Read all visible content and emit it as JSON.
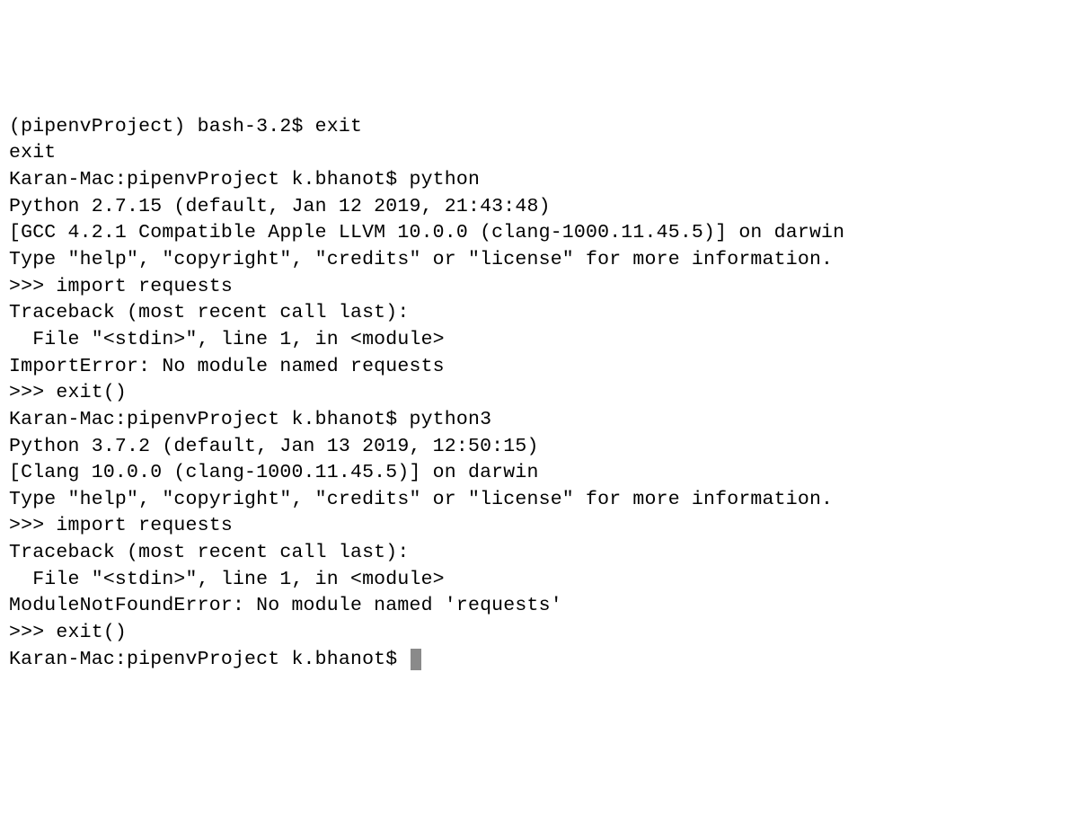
{
  "lines": [
    "(pipenvProject) bash-3.2$ exit",
    "exit",
    "Karan-Mac:pipenvProject k.bhanot$ python",
    "Python 2.7.15 (default, Jan 12 2019, 21:43:48) ",
    "[GCC 4.2.1 Compatible Apple LLVM 10.0.0 (clang-1000.11.45.5)] on darwin",
    "Type \"help\", \"copyright\", \"credits\" or \"license\" for more information.",
    ">>> import requests",
    "Traceback (most recent call last):",
    "  File \"<stdin>\", line 1, in <module>",
    "ImportError: No module named requests",
    ">>> exit()",
    "Karan-Mac:pipenvProject k.bhanot$ python3",
    "Python 3.7.2 (default, Jan 13 2019, 12:50:15) ",
    "[Clang 10.0.0 (clang-1000.11.45.5)] on darwin",
    "Type \"help\", \"copyright\", \"credits\" or \"license\" for more information.",
    ">>> import requests",
    "Traceback (most recent call last):",
    "  File \"<stdin>\", line 1, in <module>",
    "ModuleNotFoundError: No module named 'requests'",
    ">>> exit()",
    "Karan-Mac:pipenvProject k.bhanot$ "
  ]
}
